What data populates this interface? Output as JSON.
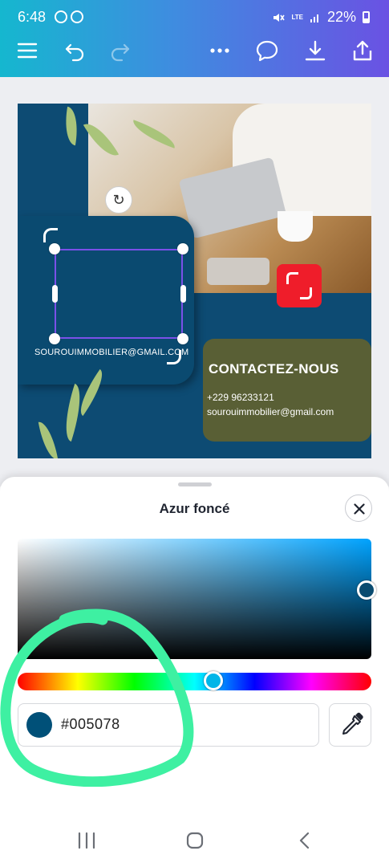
{
  "status_bar": {
    "time": "6:48",
    "network": "LTE",
    "battery": "22%"
  },
  "toolbar": {
    "icons": [
      "menu-icon",
      "undo-icon",
      "redo-icon",
      "more-icon",
      "comment-icon",
      "download-icon",
      "share-icon"
    ]
  },
  "design": {
    "email_caps": "SOUROUIMMOBILIER@GMAIL.COM",
    "contact_title": "CONTACTEZ-NOUS",
    "phone": "+229 96233121",
    "email": "sourouimmobilier@gmail.com"
  },
  "color_sheet": {
    "title": "Azur foncé",
    "hex_value": "#005078",
    "swatch_color": "#005078"
  },
  "colors": {
    "brand_gradient_start": "#15b7cf",
    "brand_gradient_end": "#6a52e3",
    "design_blue": "#0d4b73",
    "contact_box": "#595f35",
    "selection": "#7b50e8",
    "annotation_green": "#3ef0a2"
  }
}
